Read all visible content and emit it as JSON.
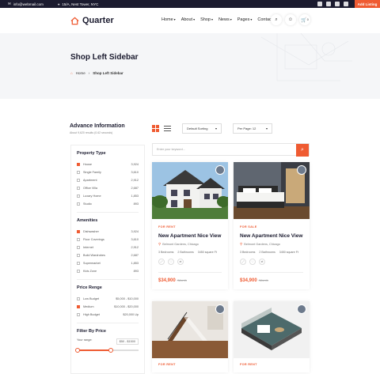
{
  "topbar": {
    "email": "info@webmail.com",
    "address": "15/A, Nest Tower, NYC",
    "add_listing": "Add Listing"
  },
  "logo": {
    "name": "Quarter"
  },
  "menu": [
    "Home",
    "About",
    "Shop",
    "News",
    "Pages",
    "Contact"
  ],
  "cart_count": "0",
  "hero": {
    "title": "Shop Left Sidebar",
    "breadcrumb_home": "Home",
    "breadcrumb_current": "Shop Left Sidebar"
  },
  "sidebar": {
    "title": "Advance Information",
    "subtitle": "About 9,620 results (0.62 seconds)",
    "property_type": {
      "title": "Property Type",
      "items": [
        {
          "label": "House",
          "count": "3,924",
          "checked": true
        },
        {
          "label": "Single Family",
          "count": "3,610",
          "checked": false
        },
        {
          "label": "Apartment",
          "count": "2,912",
          "checked": false
        },
        {
          "label": "Office Villa",
          "count": "2,687",
          "checked": false
        },
        {
          "label": "Luxary Home",
          "count": "1,853",
          "checked": false
        },
        {
          "label": "Studio",
          "count": "893",
          "checked": false
        }
      ]
    },
    "amenities": {
      "title": "Amenities",
      "items": [
        {
          "label": "Dishwasher",
          "count": "3,924",
          "checked": true
        },
        {
          "label": "Floor Coverings",
          "count": "3,610",
          "checked": false
        },
        {
          "label": "Internet",
          "count": "2,912",
          "checked": false
        },
        {
          "label": "Build Wardrobes",
          "count": "2,687",
          "checked": false
        },
        {
          "label": "Supermarket",
          "count": "1,853",
          "checked": false
        },
        {
          "label": "Kids Zone",
          "count": "893",
          "checked": false
        }
      ]
    },
    "price_range": {
      "title": "Price Renge",
      "items": [
        {
          "label": "Low Budget",
          "count": "$5,000 - $10,000",
          "checked": false
        },
        {
          "label": "Medium",
          "count": "$10,000 - $20,000",
          "checked": true
        },
        {
          "label": "High Budget",
          "count": "$20,000 Up",
          "checked": false
        }
      ]
    },
    "filter_price": {
      "title": "Filter By Price",
      "label": "Your range:",
      "range": "$50 - $1500",
      "fill_fraction": 0.55
    }
  },
  "toolbar": {
    "sort": "Default Sorting",
    "per_page": "Per Page: 12"
  },
  "search": {
    "placeholder": "Enter your keyword..."
  },
  "cards": [
    {
      "tag": "FOR RENT",
      "title": "New Apartment Nice View",
      "location": "Belmont Gardens, Chicago",
      "beds": "3 Bedrooms",
      "baths": "2 Bathrooms",
      "area": "3450 square Ft",
      "price": "$34,900",
      "old_price": "/Month"
    },
    {
      "tag": "FOR SALE",
      "title": "New Apartment Nice View",
      "location": "Belmont Gardens, Chicago",
      "beds": "3 Bedrooms",
      "baths": "2 Bathrooms",
      "area": "3450 square Ft",
      "price": "$34,900",
      "old_price": "/Month"
    },
    {
      "tag": "FOR RENT"
    },
    {
      "tag": "FOR RENT"
    }
  ],
  "colors": {
    "accent": "#ef5b32",
    "dark": "#1b1b2f"
  }
}
